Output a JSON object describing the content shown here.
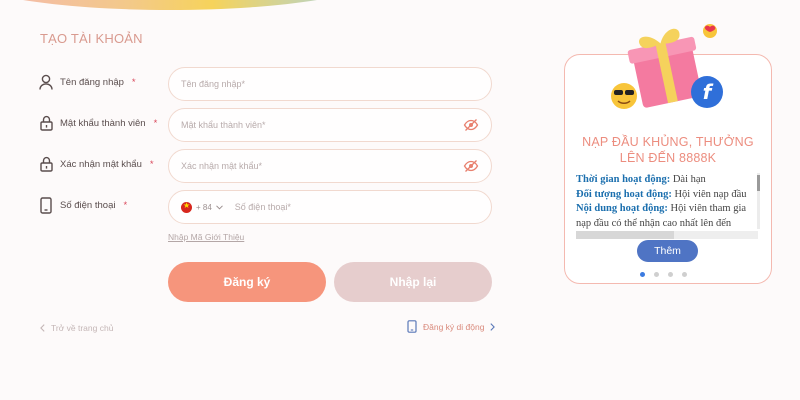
{
  "form": {
    "title": "TẠO TÀI KHOẢN",
    "fields": [
      {
        "label": "Tên đăng nhập",
        "required": "*",
        "placeholder": "Tên đăng nhập*",
        "icon": "user-icon"
      },
      {
        "label": "Mật khẩu thành viên",
        "required": "*",
        "placeholder": "Mật khẩu thành viên*",
        "icon": "lock-icon"
      },
      {
        "label": "Xác nhận mật khẩu",
        "required": "*",
        "placeholder": "Xác nhận mật khẩu*",
        "icon": "lock-icon"
      },
      {
        "label": "Số điện thoại",
        "required": "*",
        "placeholder": "Số điện thoại*",
        "icon": "phone-icon",
        "prefix": "+ 84"
      }
    ],
    "referral_link": "Nhập Mã Giới Thiệu",
    "register_button": "Đăng ký",
    "reset_button": "Nhập lại",
    "back_link": "Trở về trang chủ",
    "mobile_link": "Đăng ký di động"
  },
  "promo": {
    "title_line1": "NẠP ĐẦU KHỦNG, THƯỞNG",
    "title_line2": "LÊN ĐẾN 8888K",
    "items": [
      {
        "key": "Thời gian hoạt động:",
        "value": " Dài hạn"
      },
      {
        "key": "Đối tượng hoạt động:",
        "value": " Hội viên nạp đầu"
      },
      {
        "key": "Nội dung hoạt động:",
        "value": " Hội viên tham gia nạp đầu có thể nhận cao nhất lên đến"
      }
    ],
    "more_button": "Thêm",
    "carousel_active_index": 0,
    "carousel_count": 4
  },
  "colors": {
    "accent": "#f6957c",
    "reset": "#e6cdcd",
    "more": "#4f74c4",
    "promo_title": "#ec8d7f",
    "required": "#d9475a"
  }
}
